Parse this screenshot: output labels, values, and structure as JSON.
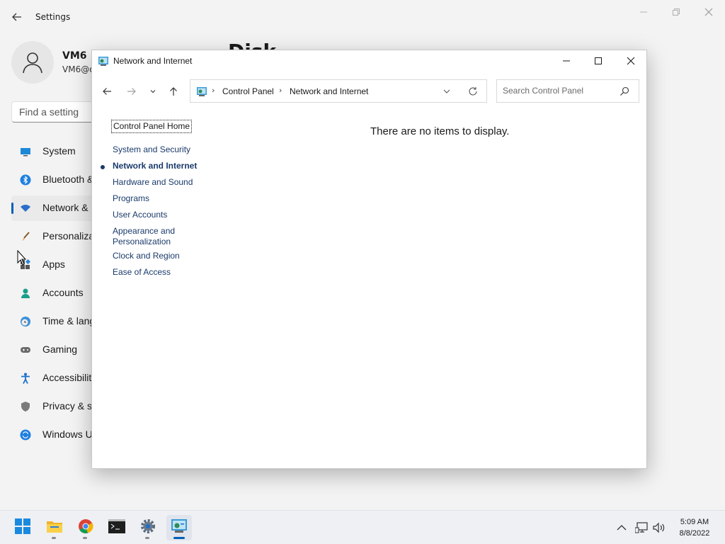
{
  "settings": {
    "title": "Settings",
    "heading": "Disk",
    "user": {
      "name": "VM6",
      "email": "VM6@o"
    },
    "search_placeholder": "Find a setting",
    "nav": [
      {
        "label": "System",
        "icon": "monitor-icon"
      },
      {
        "label": "Bluetooth &",
        "icon": "bluetooth-icon"
      },
      {
        "label": "Network &",
        "icon": "wifi-icon",
        "active": true
      },
      {
        "label": "Personaliza",
        "icon": "brush-icon"
      },
      {
        "label": "Apps",
        "icon": "apps-icon"
      },
      {
        "label": "Accounts",
        "icon": "person-icon"
      },
      {
        "label": "Time & lang",
        "icon": "clock-globe-icon"
      },
      {
        "label": "Gaming",
        "icon": "gamepad-icon"
      },
      {
        "label": "Accessibilit",
        "icon": "accessibility-icon"
      },
      {
        "label": "Privacy & s",
        "icon": "shield-icon"
      },
      {
        "label": "Windows U",
        "icon": "update-icon"
      }
    ]
  },
  "control_panel": {
    "window_title": "Network and Internet",
    "breadcrumb": [
      "Control Panel",
      "Network and Internet"
    ],
    "search_placeholder": "Search Control Panel",
    "home_link": "Control Panel Home",
    "categories": [
      "System and Security",
      "Network and Internet",
      "Hardware and Sound",
      "Programs",
      "User Accounts",
      "Appearance and",
      "Personalization",
      "Clock and Region",
      "Ease of Access"
    ],
    "empty_message": "There are no items to display."
  },
  "taskbar": {
    "apps": [
      "start-icon",
      "file-explorer-icon",
      "chrome-icon",
      "terminal-icon",
      "settings-gear-icon",
      "control-panel-icon"
    ],
    "time": "5:09 AM",
    "date": "8/8/2022"
  },
  "colors": {
    "accent": "#005fb8",
    "link": "#1a3a6b"
  }
}
